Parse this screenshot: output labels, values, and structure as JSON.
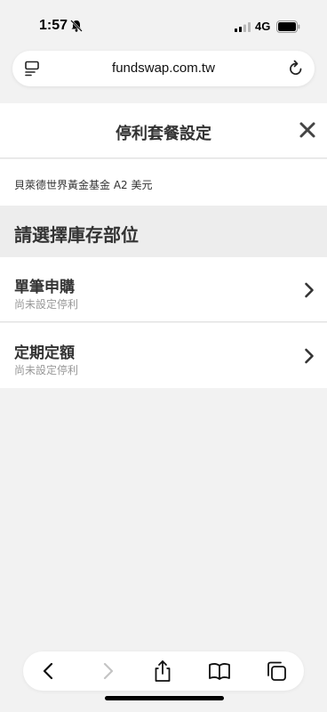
{
  "status": {
    "time": "1:57",
    "network": "4G"
  },
  "browser": {
    "url": "fundswap.com.tw"
  },
  "sheet": {
    "title": "停利套餐設定",
    "fund_name": "貝萊德世界黃金基金 A2 美元",
    "section_title": "請選擇庫存部位",
    "options": [
      {
        "title": "單筆申購",
        "subtitle": "尚未設定停利"
      },
      {
        "title": "定期定額",
        "subtitle": "尚未設定停利"
      }
    ]
  },
  "icons": {
    "status_bell": "bell-slash-icon",
    "signal": "cellular-signal-icon",
    "battery": "battery-icon",
    "reader": "reader-mode-icon",
    "reload": "reload-icon",
    "close": "close-icon",
    "chevron": "chevron-right-icon",
    "back": "back-arrow-icon",
    "forward": "forward-arrow-icon",
    "share": "share-icon",
    "bookmarks": "bookmarks-icon",
    "tabs": "tabs-icon"
  }
}
